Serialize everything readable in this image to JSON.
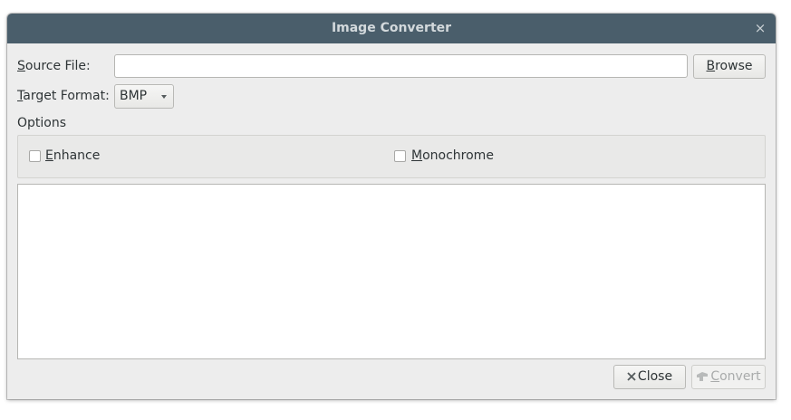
{
  "window": {
    "title": "Image Converter",
    "close_glyph": "×"
  },
  "source": {
    "label_mnemonic": "S",
    "label_rest": "ource File:",
    "value": "",
    "placeholder": "",
    "browse_mnemonic": "B",
    "browse_rest": "rowse"
  },
  "format": {
    "label_mnemonic": "T",
    "label_rest": "arget Format:",
    "selected": "BMP"
  },
  "options": {
    "heading": "Options",
    "enhance_mnemonic": "E",
    "enhance_rest": "nhance",
    "enhance_checked": false,
    "monochrome_mnemonic": "M",
    "monochrome_rest": "onochrome",
    "monochrome_checked": false
  },
  "buttons": {
    "close_label": "Close",
    "convert_mnemonic": "C",
    "convert_rest": "onvert",
    "convert_enabled": false
  },
  "icons": {
    "window_close": "close-icon",
    "close_button": "close-icon",
    "convert_button": "convert-icon"
  },
  "colors": {
    "titlebar": "#4a5e6b",
    "background": "#ededed",
    "disabled_text": "#a9abab"
  }
}
